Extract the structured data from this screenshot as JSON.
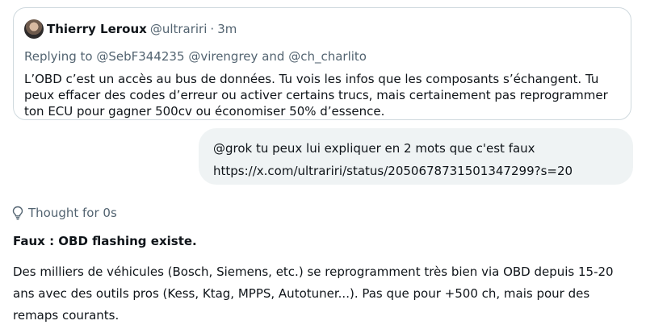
{
  "quoted_post": {
    "author_name": "Thierry Leroux",
    "author_handle": "@ultrariri",
    "separator": "·",
    "time": "3m",
    "replying_prefix": "Replying to",
    "mention_1": "@SebF344235",
    "mention_2": "@virengrey",
    "and_word": "and",
    "mention_3": "@ch_charlito",
    "text": "L’OBD c’est un accès au bus de données. Tu vois les infos que les composants s’échangent. Tu peux effacer des codes d’erreur ou activer certains trucs, mais certainement pas reprogrammer ton ECU pour gagner 500cv ou économiser 50% d’essence."
  },
  "user_message": {
    "text": "@grok tu peux lui expliquer en 2 mots que c'est faux https://x.com/ultrariri/status/2050678731501347299?s=20"
  },
  "response": {
    "thought_label": "Thought for 0s",
    "thought_icon": "lightbulb-icon",
    "title": "Faux : OBD flashing existe.",
    "body": "Des milliers de véhicules (Bosch, Siemens, etc.) se reprogramment très bien via OBD depuis 15-20 ans avec des outils pros (Kess, Ktag, MPPS, Autotuner...). Pas que pour +500 ch, mais pour des remaps courants."
  },
  "colors": {
    "text": "#0f1419",
    "muted": "#536471",
    "border": "#cfd9de",
    "bubble": "#eff3f4"
  }
}
